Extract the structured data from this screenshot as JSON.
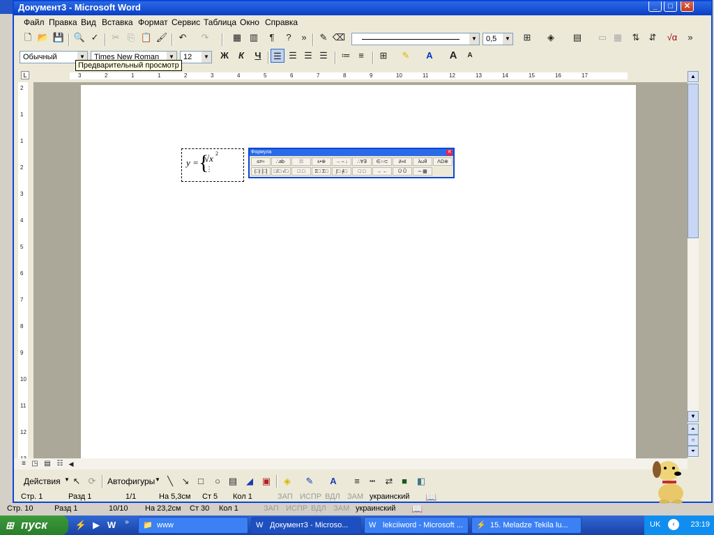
{
  "window": {
    "title": "Документ3 - Microsoft Word"
  },
  "menu": [
    "Файл",
    "Правка",
    "Вид",
    "Вставка",
    "Формат",
    "Сервис",
    "Таблица",
    "Окно",
    "Справка"
  ],
  "toolbar": {
    "line_weight": "0,5"
  },
  "formatting": {
    "style": "Обычный",
    "font": "Times New Roman",
    "size": "12",
    "bold": "Ж",
    "italic": "К",
    "underline": "Ч"
  },
  "tooltip": "Предварительный просмотр",
  "ruler": {
    "h_ticks": [
      "3",
      "2",
      "1",
      "1",
      "2",
      "3",
      "4",
      "5",
      "6",
      "7",
      "8",
      "9",
      "10",
      "11",
      "12",
      "13",
      "14",
      "15",
      "16",
      "17"
    ],
    "v_ticks": [
      "2",
      "1",
      "1",
      "2",
      "3",
      "4",
      "5",
      "6",
      "7",
      "8",
      "9",
      "10",
      "11",
      "12",
      "13"
    ]
  },
  "formula": {
    "y": "y",
    "eq": "=",
    "root": "√x",
    "exp": "2",
    "box": "⋮"
  },
  "formula_toolbar": {
    "title": "Формула",
    "row1": [
      "≤≠≈",
      "∴ab·",
      "⁞⁞⁞",
      "±•⊗",
      "→⇔↓",
      "∴∀∃",
      "∈∩⊂",
      "∂∞ℓ",
      "λωθ",
      "ΛΩ⊗"
    ],
    "row2": [
      "(□) [□]",
      "□/□ √□",
      "□ □",
      "Σ□ Σ□",
      "∫□ ∮□",
      "□ □",
      "→ ←",
      "Ū Ũ",
      "▫▫ ▦"
    ]
  },
  "drawing": {
    "actions": "Действия",
    "autoshapes": "Автофигуры"
  },
  "status": {
    "page": "Стр. 1",
    "section": "Разд 1",
    "pages": "1/1",
    "at": "На 5,3см",
    "line": "Ст 5",
    "col": "Кол 1",
    "rec": "ЗАП",
    "trk": "ИСПР",
    "ext": "ВДЛ",
    "ovr": "ЗАМ",
    "lang": "украинский"
  },
  "status2": {
    "page": "Стр. 10",
    "section": "Разд 1",
    "pages": "10/10",
    "at": "На 23,2см",
    "line": "Ст 30",
    "col": "Кол 1",
    "rec": "ЗАП",
    "trk": "ИСПР",
    "ext": "ВДЛ",
    "ovr": "ЗАМ",
    "lang": "украинский"
  },
  "taskbar": {
    "start": "пуск",
    "tasks": [
      {
        "label": "www"
      },
      {
        "label": "Документ3 - Microso..."
      },
      {
        "label": "lekciiword - Microsoft ..."
      },
      {
        "label": "15. Meladze Tekila lu..."
      }
    ],
    "lang": "UK",
    "clock": "23:19"
  }
}
